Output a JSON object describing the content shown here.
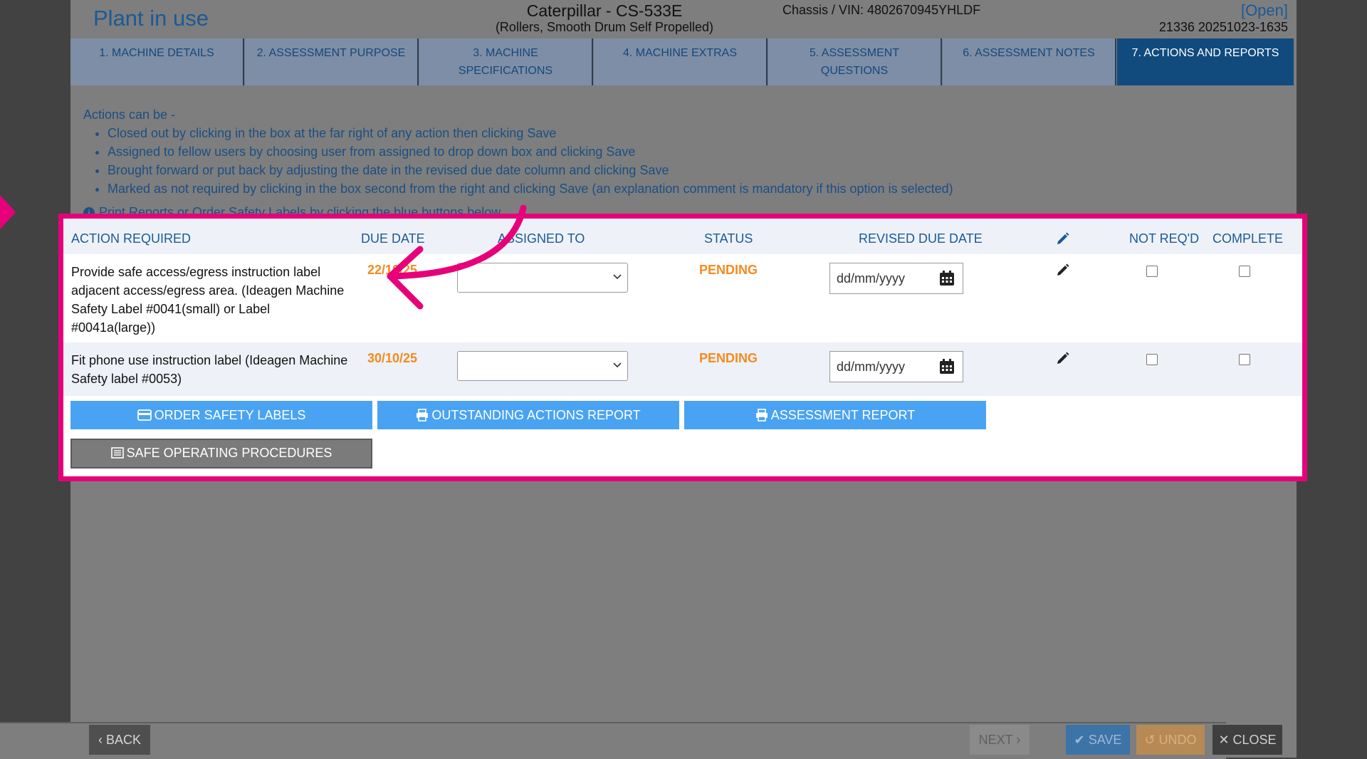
{
  "header": {
    "title": "Plant in use",
    "machine_name": "Caterpillar - CS-533E",
    "machine_type": "(Rollers, Smooth Drum Self Propelled)",
    "chassis": "Chassis / VIN: 4802670945YHLDF",
    "status": "[Open]",
    "reference": "21336 20251023-1635"
  },
  "tabs": [
    {
      "label": "1. MACHINE DETAILS"
    },
    {
      "label": "2. ASSESSMENT PURPOSE"
    },
    {
      "label": "3. MACHINE SPECIFICATIONS"
    },
    {
      "label": "4. MACHINE EXTRAS"
    },
    {
      "label": "5. ASSESSMENT QUESTIONS"
    },
    {
      "label": "6. ASSESSMENT NOTES"
    },
    {
      "label": "7. ACTIONS AND REPORTS",
      "active": true
    }
  ],
  "info": {
    "lead": "Actions can be -",
    "items": [
      "Closed out by clicking in the box at the far right of any action then clicking Save",
      "Assigned to fellow users by choosing user from assigned to drop down box and clicking Save",
      "Brought forward or put back by adjusting the date in the revised due date column and clicking Save",
      "Marked as not required by clicking in the box second from the right and clicking Save (an explanation comment is mandatory if this option is selected)"
    ],
    "print_note": "Print Reports or Order Safety Labels by clicking the blue buttons below"
  },
  "table": {
    "headers": {
      "action": "ACTION REQUIRED",
      "due": "DUE DATE",
      "assigned": "ASSIGNED TO",
      "status": "STATUS",
      "revised": "REVISED DUE DATE",
      "notreq": "NOT REQ'D",
      "complete": "COMPLETE"
    },
    "rows": [
      {
        "action": "Provide safe access/egress instruction label adjacent access/egress area. (Ideagen Machine Safety Label #0041(small) or Label #0041a(large))",
        "due": "22/10/25",
        "assigned": "",
        "status": "PENDING",
        "revised_placeholder": "dd/mm/yyyy",
        "not_required": false,
        "complete": false
      },
      {
        "action": "Fit phone use instruction label (Ideagen Machine Safety label #0053)",
        "due": "30/10/25",
        "assigned": "",
        "status": "PENDING",
        "revised_placeholder": "dd/mm/yyyy",
        "not_required": false,
        "complete": false
      }
    ]
  },
  "buttons": {
    "order_labels": "ORDER SAFETY LABELS",
    "outstanding_report": "OUTSTANDING ACTIONS REPORT",
    "assessment_report": "ASSESSMENT REPORT",
    "sop": "SAFE OPERATING PROCEDURES"
  },
  "footer": {
    "back": "BACK",
    "next": "NEXT",
    "save": "SAVE",
    "undo": "UNDO",
    "close": "CLOSE"
  },
  "colors": {
    "highlight": "#e6007a",
    "accent_blue": "#4aa3f2",
    "pending_orange": "#f58a1f",
    "active_tab": "#114b7d"
  }
}
